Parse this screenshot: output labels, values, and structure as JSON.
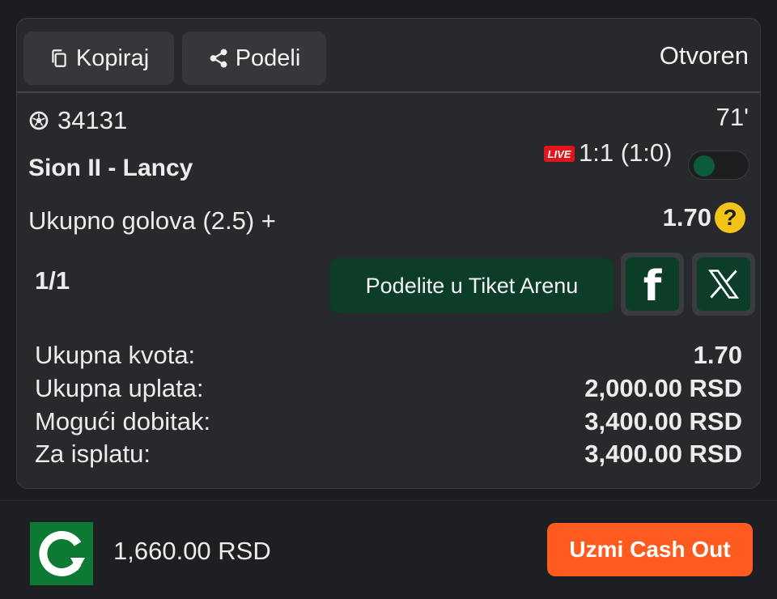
{
  "ticket": {
    "copy_label": "Kopiraj",
    "share_label": "Podeli",
    "status": "Otvoren"
  },
  "event": {
    "id": "34131",
    "minute": "71'",
    "teams": "Sion II - Lancy",
    "live_badge": "LIVE",
    "score": "1:1 (1:0)",
    "market": "Ukupno golova (2.5) +",
    "odd": "1.70",
    "help": "?"
  },
  "share": {
    "count": "1/1",
    "arena_label": "Podelite u Tiket Arenu",
    "facebook": "f"
  },
  "summary": {
    "total_odd_label": "Ukupna kvota:",
    "total_odd_value": "1.70",
    "stake_label": "Ukupna uplata:",
    "stake_value": "2,000.00 RSD",
    "possible_win_label": "Mogući dobitak:",
    "possible_win_value": "3,400.00 RSD",
    "payout_label": "Za isplatu:",
    "payout_value": "3,400.00 RSD"
  },
  "cashout": {
    "amount": "1,660.00 RSD",
    "button_label": "Uzmi Cash Out"
  },
  "colors": {
    "background": "#1c1d20",
    "card": "#27292c",
    "accent_green": "#0b3d29",
    "live_red": "#e0161c",
    "help_yellow": "#f2c41a",
    "cashout_orange": "#ff5a1f"
  },
  "icons": [
    "copy-icon",
    "share-icon",
    "soccer-ball-icon",
    "help-icon",
    "facebook-icon",
    "x-icon",
    "cashout-logo-icon"
  ]
}
